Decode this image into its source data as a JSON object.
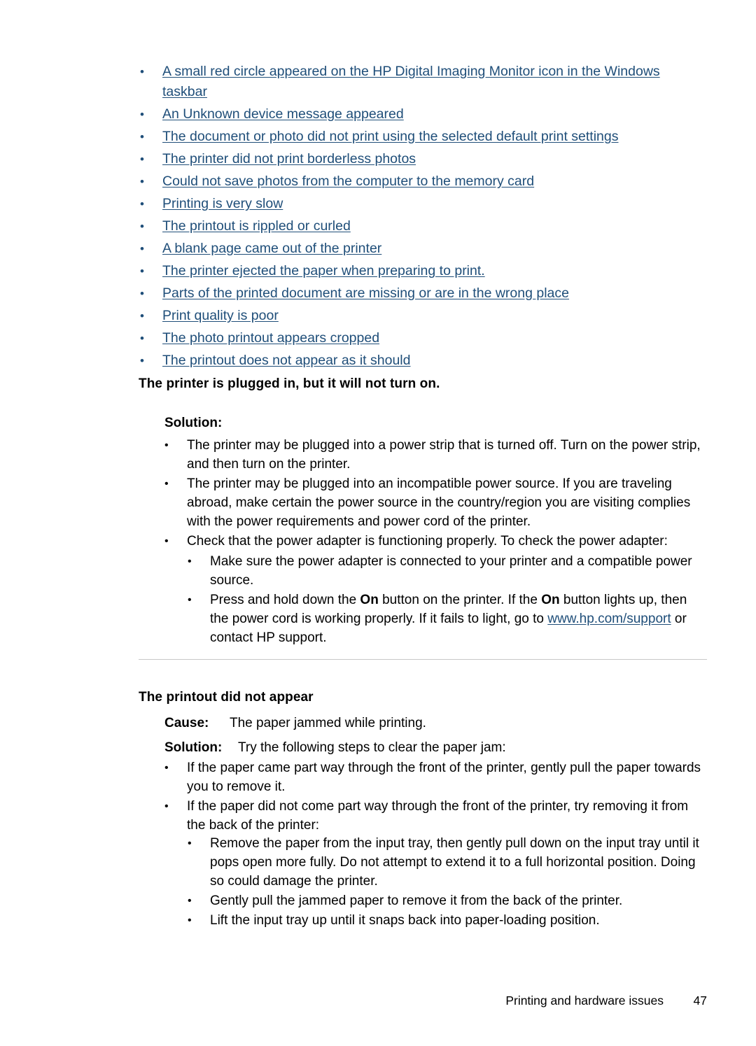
{
  "document": {
    "page_number": "47",
    "footer_title": "Printing and hardware issues",
    "link_color": "#1f4e79",
    "text_color": "#000000"
  },
  "toc": {
    "items": [
      {
        "label": "A small red circle appeared on the HP Digital Imaging Monitor icon in the Windows taskbar"
      },
      {
        "label": "An Unknown device message appeared"
      },
      {
        "label": "The document or photo did not print using the selected default print settings"
      },
      {
        "label": "The printer did not print borderless photos"
      },
      {
        "label": "Could not save photos from the computer to the memory card"
      },
      {
        "label": "Printing is very slow"
      },
      {
        "label": "The printout is rippled or curled"
      },
      {
        "label": "A blank page came out of the printer"
      },
      {
        "label": "The printer ejected the paper when preparing to print."
      },
      {
        "label": "Parts of the printed document are missing or are in the wrong place"
      },
      {
        "label": "Print quality is poor"
      },
      {
        "label": "The photo printout appears cropped"
      },
      {
        "label": "The printout does not appear as it should"
      }
    ],
    "bullet": "•"
  },
  "section_one": {
    "heading": "The printer is plugged in, but it will not turn on.",
    "solution_label": "Solution:",
    "bullets": [
      "The printer may be plugged into a power strip that is turned off. Turn on the power strip, and then turn on the printer.",
      "The printer may be plugged into an incompatible power source. If you are traveling abroad, make certain the power source in the country/region you are visiting complies with the power requirements and power cord of the printer.",
      "Check that the power adapter is functioning properly. To check the power adapter:"
    ],
    "sub_bullets": [
      {
        "parts": [
          {
            "type": "text",
            "value": "Make sure the power adapter is connected to your printer and a compatible power source."
          }
        ]
      },
      {
        "parts": [
          {
            "type": "text",
            "value": "Press and hold down the "
          },
          {
            "type": "bold",
            "value": "On"
          },
          {
            "type": "text",
            "value": " button on the printer. If the "
          },
          {
            "type": "bold",
            "value": "On"
          },
          {
            "type": "text",
            "value": " button lights up, then the power cord is working properly. If it fails to light, go to "
          },
          {
            "type": "link",
            "value": "www.hp.com/support"
          },
          {
            "type": "text",
            "value": " or contact HP support."
          }
        ]
      }
    ]
  },
  "section_two": {
    "heading": "The printout did not appear",
    "cause_label": "Cause:",
    "cause_value": "The paper jammed while printing.",
    "solution_label": "Solution:",
    "solution_value": "Try the following steps to clear the paper jam:",
    "bullets": [
      "If the paper came part way through the front of the printer, gently pull the paper towards you to remove it.",
      "If the paper did not come part way through the front of the printer, try removing it from the back of the printer:"
    ],
    "sub_bullets": [
      "Remove the paper from the input tray, then gently pull down on the input tray until it pops open more fully. Do not attempt to extend it to a full horizontal position. Doing so could damage the printer.",
      "Gently pull the jammed paper to remove it from the back of the printer.",
      "Lift the input tray up until it snaps back into paper-loading position."
    ]
  }
}
